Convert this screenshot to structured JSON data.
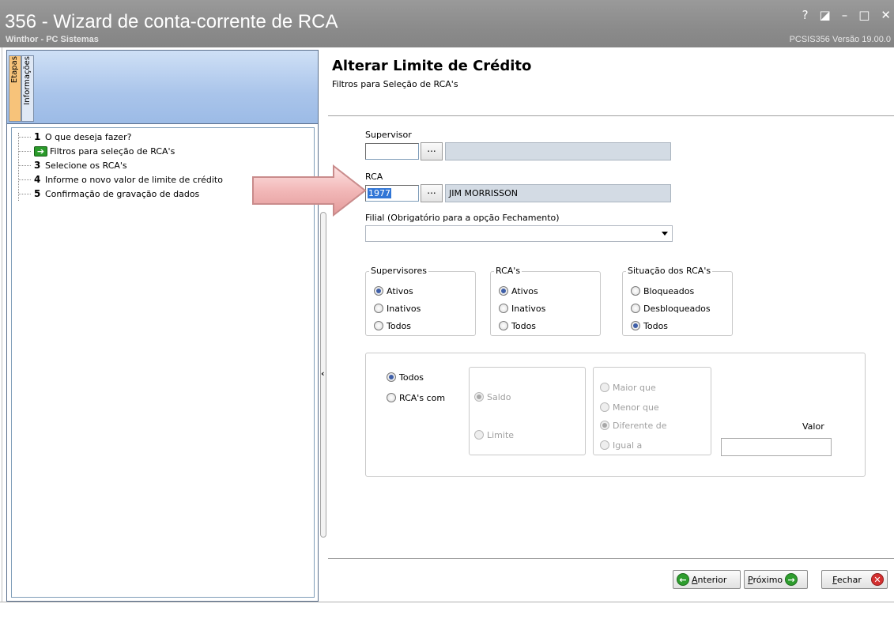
{
  "window": {
    "title": "356 - Wizard de conta-corrente de RCA",
    "subtitle": "Winthor - PC Sistemas",
    "app_info": "PCSIS356  Versão 19.00.0",
    "controls": {
      "help": "?",
      "restore": "◪",
      "minimize": "–",
      "maximize": "□",
      "close": "✕"
    }
  },
  "left": {
    "tabs": [
      {
        "label": "Etapas",
        "active": true
      },
      {
        "label": "Informações",
        "active": false
      }
    ],
    "steps": [
      {
        "num": "1",
        "label": "O que deseja fazer?",
        "current": false
      },
      {
        "num": "",
        "label": "Filtros para seleção de RCA's",
        "current": true
      },
      {
        "num": "3",
        "label": "Selecione os RCA's",
        "current": false
      },
      {
        "num": "4",
        "label": "Informe o novo valor de limite de crédito",
        "current": false
      },
      {
        "num": "5",
        "label": "Confirmação de gravação de dados",
        "current": false
      }
    ]
  },
  "main": {
    "title": "Alterar Limite de Crédito",
    "subtitle": "Filtros para Seleção de RCA's",
    "supervisor": {
      "label": "Supervisor",
      "code": "",
      "lookup_label": "...",
      "name": ""
    },
    "rca": {
      "label": "RCA",
      "code": "1977",
      "lookup_label": "...",
      "name": "JIM MORRISSON"
    },
    "filial": {
      "label": "Filial (Obrigatório para a opção Fechamento)",
      "value": ""
    },
    "groups": {
      "supervisores": {
        "label": "Supervisores",
        "options": [
          "Ativos",
          "Inativos",
          "Todos"
        ],
        "selected": "Ativos"
      },
      "rcas": {
        "label": "RCA's",
        "options": [
          "Ativos",
          "Inativos",
          "Todos"
        ],
        "selected": "Ativos"
      },
      "situacao": {
        "label": "Situação dos RCA's",
        "options": [
          "Bloqueados",
          "Desbloqueados",
          "Todos"
        ],
        "selected": "Todos"
      }
    },
    "filter": {
      "mode_options": [
        "Todos",
        "RCA's com"
      ],
      "mode_selected": "Todos",
      "field_options": [
        "Saldo",
        "Limite"
      ],
      "field_selected": "Saldo",
      "operator_options": [
        "Maior que",
        "Menor que",
        "Diferente de",
        "Igual a"
      ],
      "operator_selected": "Diferente de",
      "valor_label": "Valor",
      "valor": ""
    },
    "buttons": {
      "anterior": {
        "label": "Anterior",
        "accel": "A",
        "rest": "nterior"
      },
      "proximo": {
        "label": "Próximo",
        "accel": "P",
        "rest": "róximo"
      },
      "fechar": {
        "label": "Fechar",
        "accel": "F",
        "rest": "echar"
      }
    }
  },
  "colors": {
    "accent_green": "#2e9d2e",
    "close_red": "#d43030",
    "titlebar": "#8c8c8c",
    "tab_active": "#f7c37a",
    "selection": "#3176d6"
  }
}
